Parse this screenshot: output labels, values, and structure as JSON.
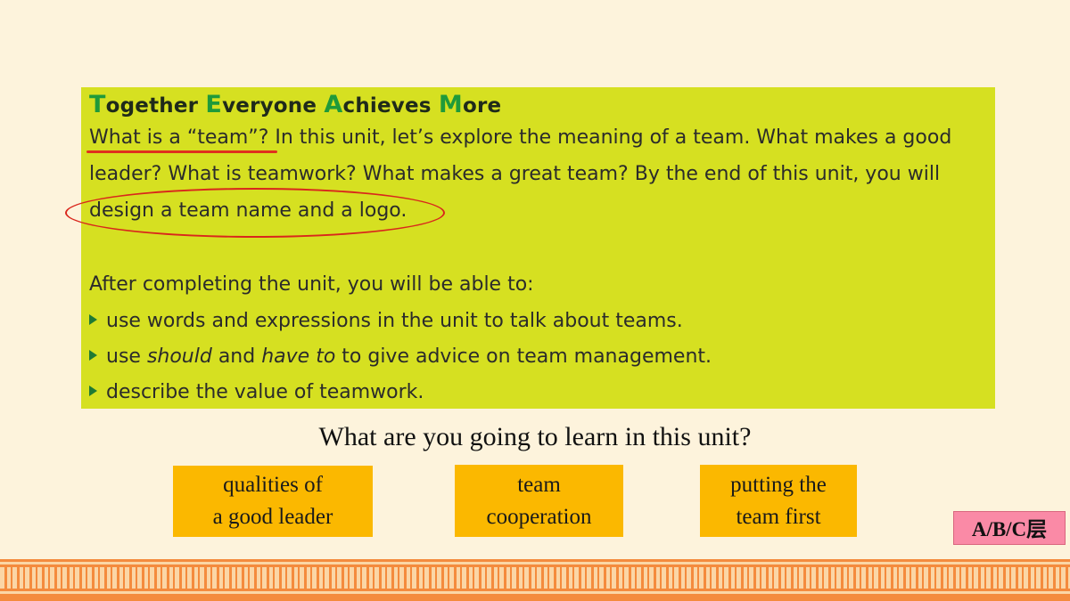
{
  "box": {
    "title": {
      "w1_cap": "T",
      "w1_rest": "ogether ",
      "w2_cap": "E",
      "w2_rest": "veryone ",
      "w3_cap": "A",
      "w3_rest": "chieves ",
      "w4_cap": "M",
      "w4_rest": "ore"
    },
    "paragraph": {
      "line1": "What is a “team”? In this unit, let’s explore the meaning of a team. What makes a good",
      "line2": "leader? What is teamwork? What makes a great team? By the end of this unit, you will",
      "line3": "design a team name and a logo."
    },
    "outcomes_intro": "After completing the unit, you will be able to:",
    "bullets": {
      "b1": "use words and expressions in the unit to talk about teams.",
      "b2_pre": "use ",
      "b2_em1": "should",
      "b2_mid": " and ",
      "b2_em2": "have to",
      "b2_post": " to give advice on team management.",
      "b3": "describe the value of teamwork."
    }
  },
  "question": "What are you going to learn in this unit?",
  "options": [
    {
      "line1": "qualities of",
      "line2": "a good leader"
    },
    {
      "line1": "team",
      "line2": "cooperation"
    },
    {
      "line1": "putting the",
      "line2": "team first"
    }
  ],
  "level_badge": "A/B/C层",
  "colors": {
    "background": "#fdf3dc",
    "box_green": "#d6e021",
    "title_caps": "#1f9a3a",
    "option_orange": "#fbb800",
    "badge_pink": "#fa8aa6",
    "annotation_red": "#e0301e",
    "border_orange": "#f48b3d"
  }
}
